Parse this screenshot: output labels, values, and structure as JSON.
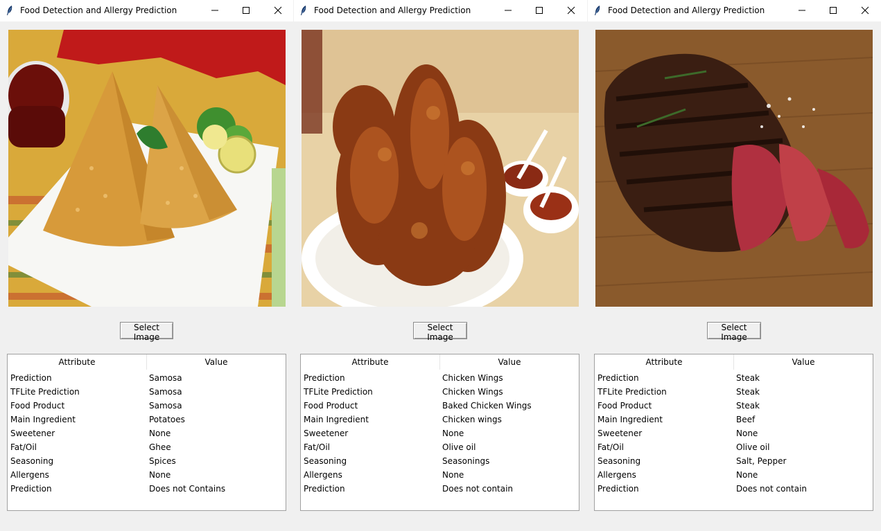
{
  "windows": [
    {
      "title": "Food Detection and Allergy Prediction",
      "button_label": "Select Image",
      "table": {
        "headers": [
          "Attribute",
          "Value"
        ],
        "rows": [
          [
            "Prediction",
            "Samosa"
          ],
          [
            "TFLite Prediction",
            "Samosa"
          ],
          [
            "Food Product",
            "Samosa"
          ],
          [
            "Main Ingredient",
            "Potatoes"
          ],
          [
            "Sweetener",
            "None"
          ],
          [
            "Fat/Oil",
            "Ghee"
          ],
          [
            "Seasoning",
            "Spices"
          ],
          [
            "Allergens",
            "None"
          ],
          [
            "Prediction",
            "Does not Contains"
          ]
        ]
      }
    },
    {
      "title": "Food Detection and Allergy Prediction",
      "button_label": "Select Image",
      "table": {
        "headers": [
          "Attribute",
          "Value"
        ],
        "rows": [
          [
            "Prediction",
            "Chicken Wings"
          ],
          [
            "TFLite Prediction",
            "Chicken Wings"
          ],
          [
            "Food Product",
            "Baked Chicken Wings"
          ],
          [
            "Main Ingredient",
            "Chicken wings"
          ],
          [
            "Sweetener",
            "None"
          ],
          [
            "Fat/Oil",
            "Olive oil"
          ],
          [
            "Seasoning",
            "Seasonings"
          ],
          [
            "Allergens",
            "None"
          ],
          [
            "Prediction",
            "Does not contain"
          ]
        ]
      }
    },
    {
      "title": "Food Detection and Allergy Prediction",
      "button_label": "Select Image",
      "table": {
        "headers": [
          "Attribute",
          "Value"
        ],
        "rows": [
          [
            "Prediction",
            "Steak"
          ],
          [
            "TFLite Prediction",
            "Steak"
          ],
          [
            "Food Product",
            "Steak"
          ],
          [
            "Main Ingredient",
            "Beef"
          ],
          [
            "Sweetener",
            "None"
          ],
          [
            "Fat/Oil",
            "Olive oil"
          ],
          [
            "Seasoning",
            "Salt, Pepper"
          ],
          [
            "Allergens",
            "None"
          ],
          [
            "Prediction",
            "Does not contain"
          ]
        ]
      }
    }
  ],
  "icons": {
    "app": "feather-icon",
    "minimize": "minimize-icon",
    "maximize": "maximize-icon",
    "close": "close-icon"
  }
}
